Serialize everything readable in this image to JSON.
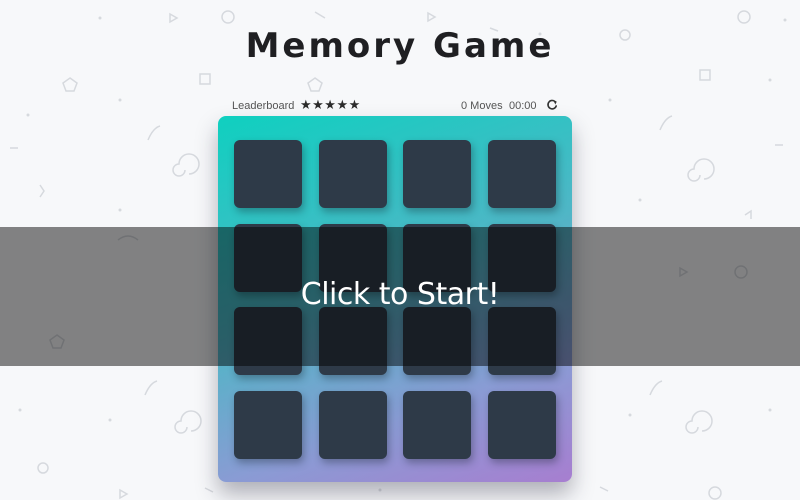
{
  "title": "Memory Game",
  "score_panel": {
    "leaderboard_label": "Leaderboard",
    "stars": "★★★★★",
    "star_rating": 5,
    "moves": "0 Moves",
    "timer": "00:00",
    "restart_icon": "restart-icon"
  },
  "deck": {
    "rows": 4,
    "columns": 4,
    "card_count": 16,
    "gradient_colors": [
      "#0fd0c0",
      "#4fb6c6",
      "#8a9bd4",
      "#a77ed0"
    ],
    "card_color": "#2e3a48"
  },
  "overlay": {
    "label": "Click to Start!"
  },
  "colors": {
    "background": "#f7f8fa",
    "title": "#1f1f22",
    "overlay": "rgba(0,0,0,0.48)"
  }
}
